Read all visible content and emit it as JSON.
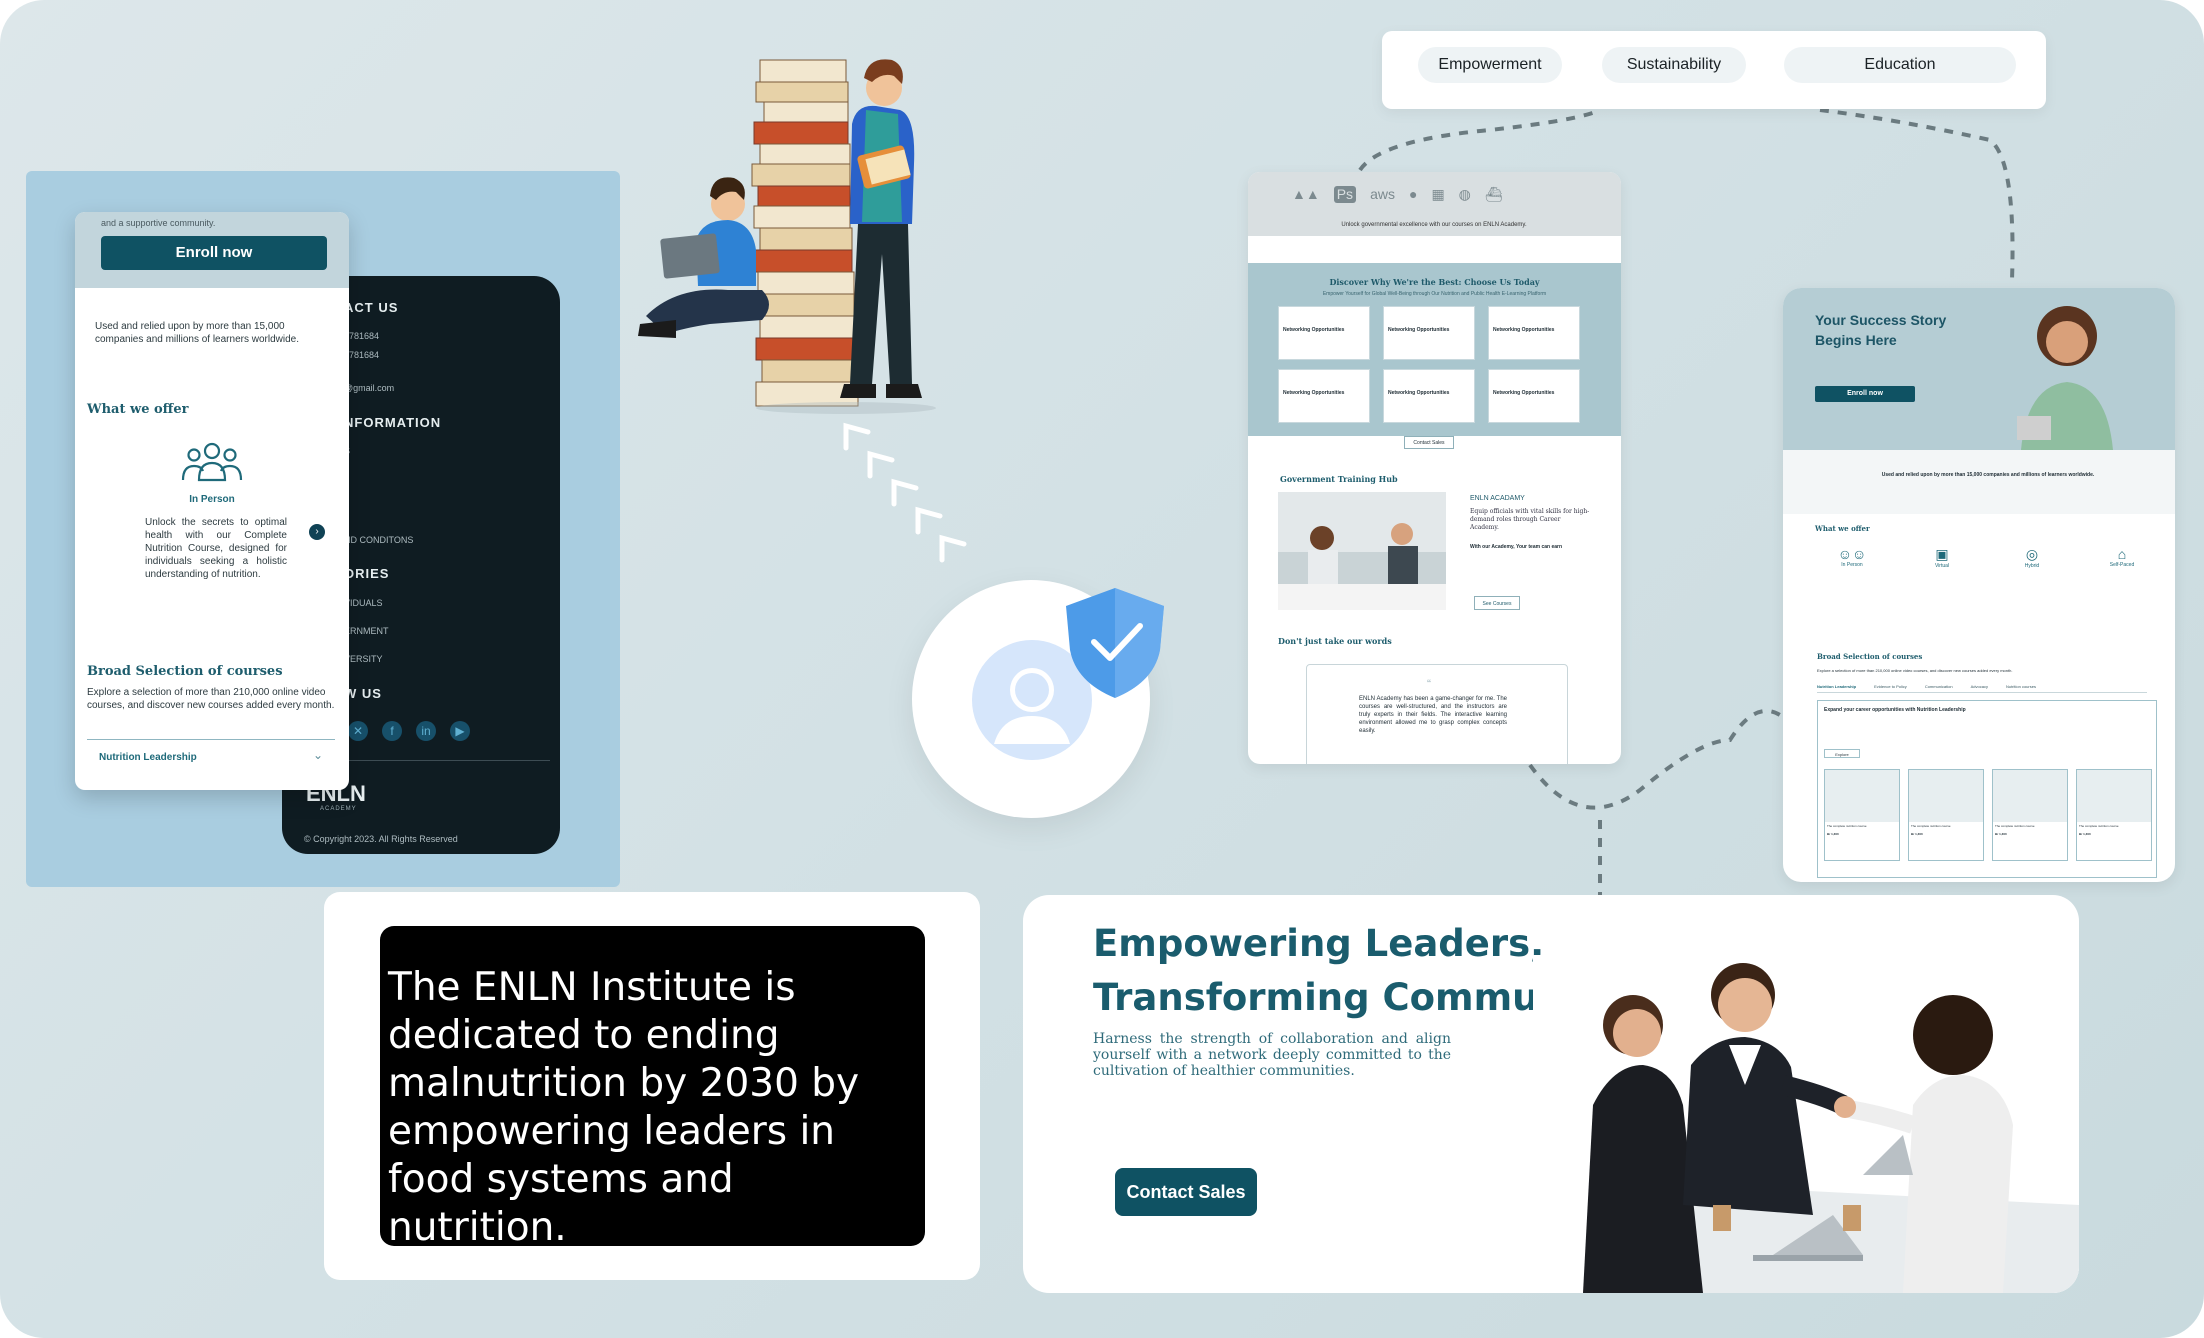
{
  "tags": [
    "Empowerment",
    "Sustainability",
    "Education"
  ],
  "mobile_light": {
    "clipped_top_text": "and a supportive community.",
    "enroll_label": "Enroll now",
    "trust_text": "Used and relied upon by more than 15,000 companies and millions of learners worldwide.",
    "offer_heading": "What we offer",
    "offer_title": "In Person",
    "offer_desc": "Unlock the secrets to optimal health with our Complete Nutrition Course, designed for individuals seeking a holistic understanding of nutrition.",
    "broad_heading": "Broad Selection of courses",
    "broad_desc": "Explore a selection of more than 210,000 online video courses, and discover new courses added every month.",
    "accordion_label": "Nutrition Leadership"
  },
  "mobile_dark": {
    "contact_heading": "ACT US",
    "phone_1": "9781684",
    "phone_2": "9781684",
    "email": "@gmail.com",
    "info_heading": "NFORMATION",
    "info_item": "S",
    "terms": "ND CONDITONS",
    "stories_heading": "ORIES",
    "story_1": "VIDUALS",
    "story_2": "ERNMENT",
    "story_3": "VERSITY",
    "follow_heading": "W US",
    "brand": "ENLN",
    "brand_sub": "ACADEMY",
    "copyright": "© Copyright 2023. All Rights Reserved"
  },
  "mid_shot": {
    "logos_caption": "Unlock governmental excellence with our courses on ENLN Academy.",
    "band_title": "Discover Why We're the Best: Choose Us Today",
    "band_sub": "Empower Yourself for Global Well-Being through Our Nutrition and Public Health E-Learning Platform",
    "card_title": "Networking Opportunities",
    "see_all": "Contact Sales",
    "hub_heading": "Government Training Hub",
    "academy_label": "ENLN ACADAMY",
    "academy_text": "Equip officials with vital skills for high-demand roles through Career Academy.",
    "academy_sub": "With our Academy, Your team can earn",
    "see_courses": "See Courses",
    "testimonial_heading": "Don't just take our words",
    "testimonial_text": "ENLN Academy has been a game-changer for me. The courses are well-structured, and the instructors are truly experts in their fields. The interactive learning environment allowed me to grasp complex concepts easily."
  },
  "right_shot": {
    "hero_title_1": "Your Success Story",
    "hero_title_2": "Begins Here",
    "hero_btn": "Enroll now",
    "trust_text": "Used and relied upon by more than 15,000 companies and millions of learners worldwide.",
    "offer_heading": "What we offer",
    "offer_items": [
      "In Person",
      "Virtual",
      "Hybrid",
      "Self-Paced"
    ],
    "broad_heading": "Broad Selection of courses",
    "broad_desc": "Explore a selection of more than 210,000 online video courses, and discover new courses added every month.",
    "tabs": [
      "Nutrition Leadership",
      "Evidence to Policy",
      "Communication",
      "Advocacy",
      "Nutrition courses"
    ],
    "feature_title": "Expand your career opportunities with Nutrition Leadership",
    "explore_label": "Explore",
    "course_title": "The complete nutrition course",
    "course_price": "Br 1,300"
  },
  "mission": {
    "text": "The ENLN Institute is dedicated to ending malnutrition by 2030 by empowering leaders in food systems and nutrition."
  },
  "hero": {
    "title_1": "Empowering Leaders,",
    "title_2": "Transforming Communities",
    "subtitle": "Harness the strength of collaboration and align yourself with a network deeply committed to the cultivation of healthier communities.",
    "cta": "Contact Sales"
  },
  "colors": {
    "brand_teal": "#0f5263",
    "heading_teal": "#1a5c6d",
    "canvas_bg": "#d3e1e5",
    "panel_blue": "#a9cde0",
    "shield_blue": "#4d9be8"
  }
}
